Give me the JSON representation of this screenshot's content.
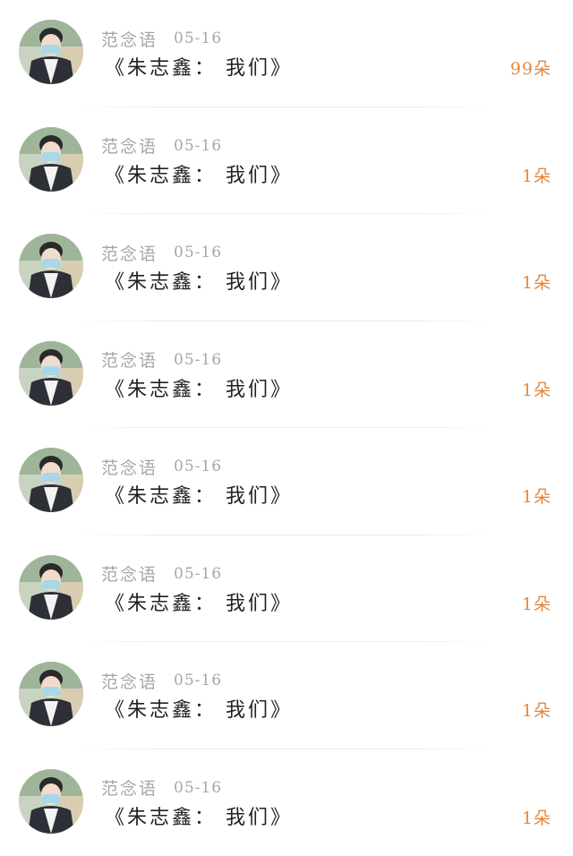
{
  "messages": [
    {
      "sender": "范念语",
      "date": "05-16",
      "title": "《朱志鑫： 我们》",
      "count": "99朵"
    },
    {
      "sender": "范念语",
      "date": "05-16",
      "title": "《朱志鑫： 我们》",
      "count": "1朵"
    },
    {
      "sender": "范念语",
      "date": "05-16",
      "title": "《朱志鑫： 我们》",
      "count": "1朵"
    },
    {
      "sender": "范念语",
      "date": "05-16",
      "title": "《朱志鑫： 我们》",
      "count": "1朵"
    },
    {
      "sender": "范念语",
      "date": "05-16",
      "title": "《朱志鑫： 我们》",
      "count": "1朵"
    },
    {
      "sender": "范念语",
      "date": "05-16",
      "title": "《朱志鑫： 我们》",
      "count": "1朵"
    },
    {
      "sender": "范念语",
      "date": "05-16",
      "title": "《朱志鑫： 我们》",
      "count": "1朵"
    },
    {
      "sender": "范念语",
      "date": "05-16",
      "title": "《朱志鑫： 我们》",
      "count": "1朵"
    }
  ],
  "colors": {
    "accent": "#e3883d",
    "meta_text": "#a6a6a6",
    "title_text": "#222222"
  },
  "icons": {
    "avatar": "user-avatar-photo"
  }
}
